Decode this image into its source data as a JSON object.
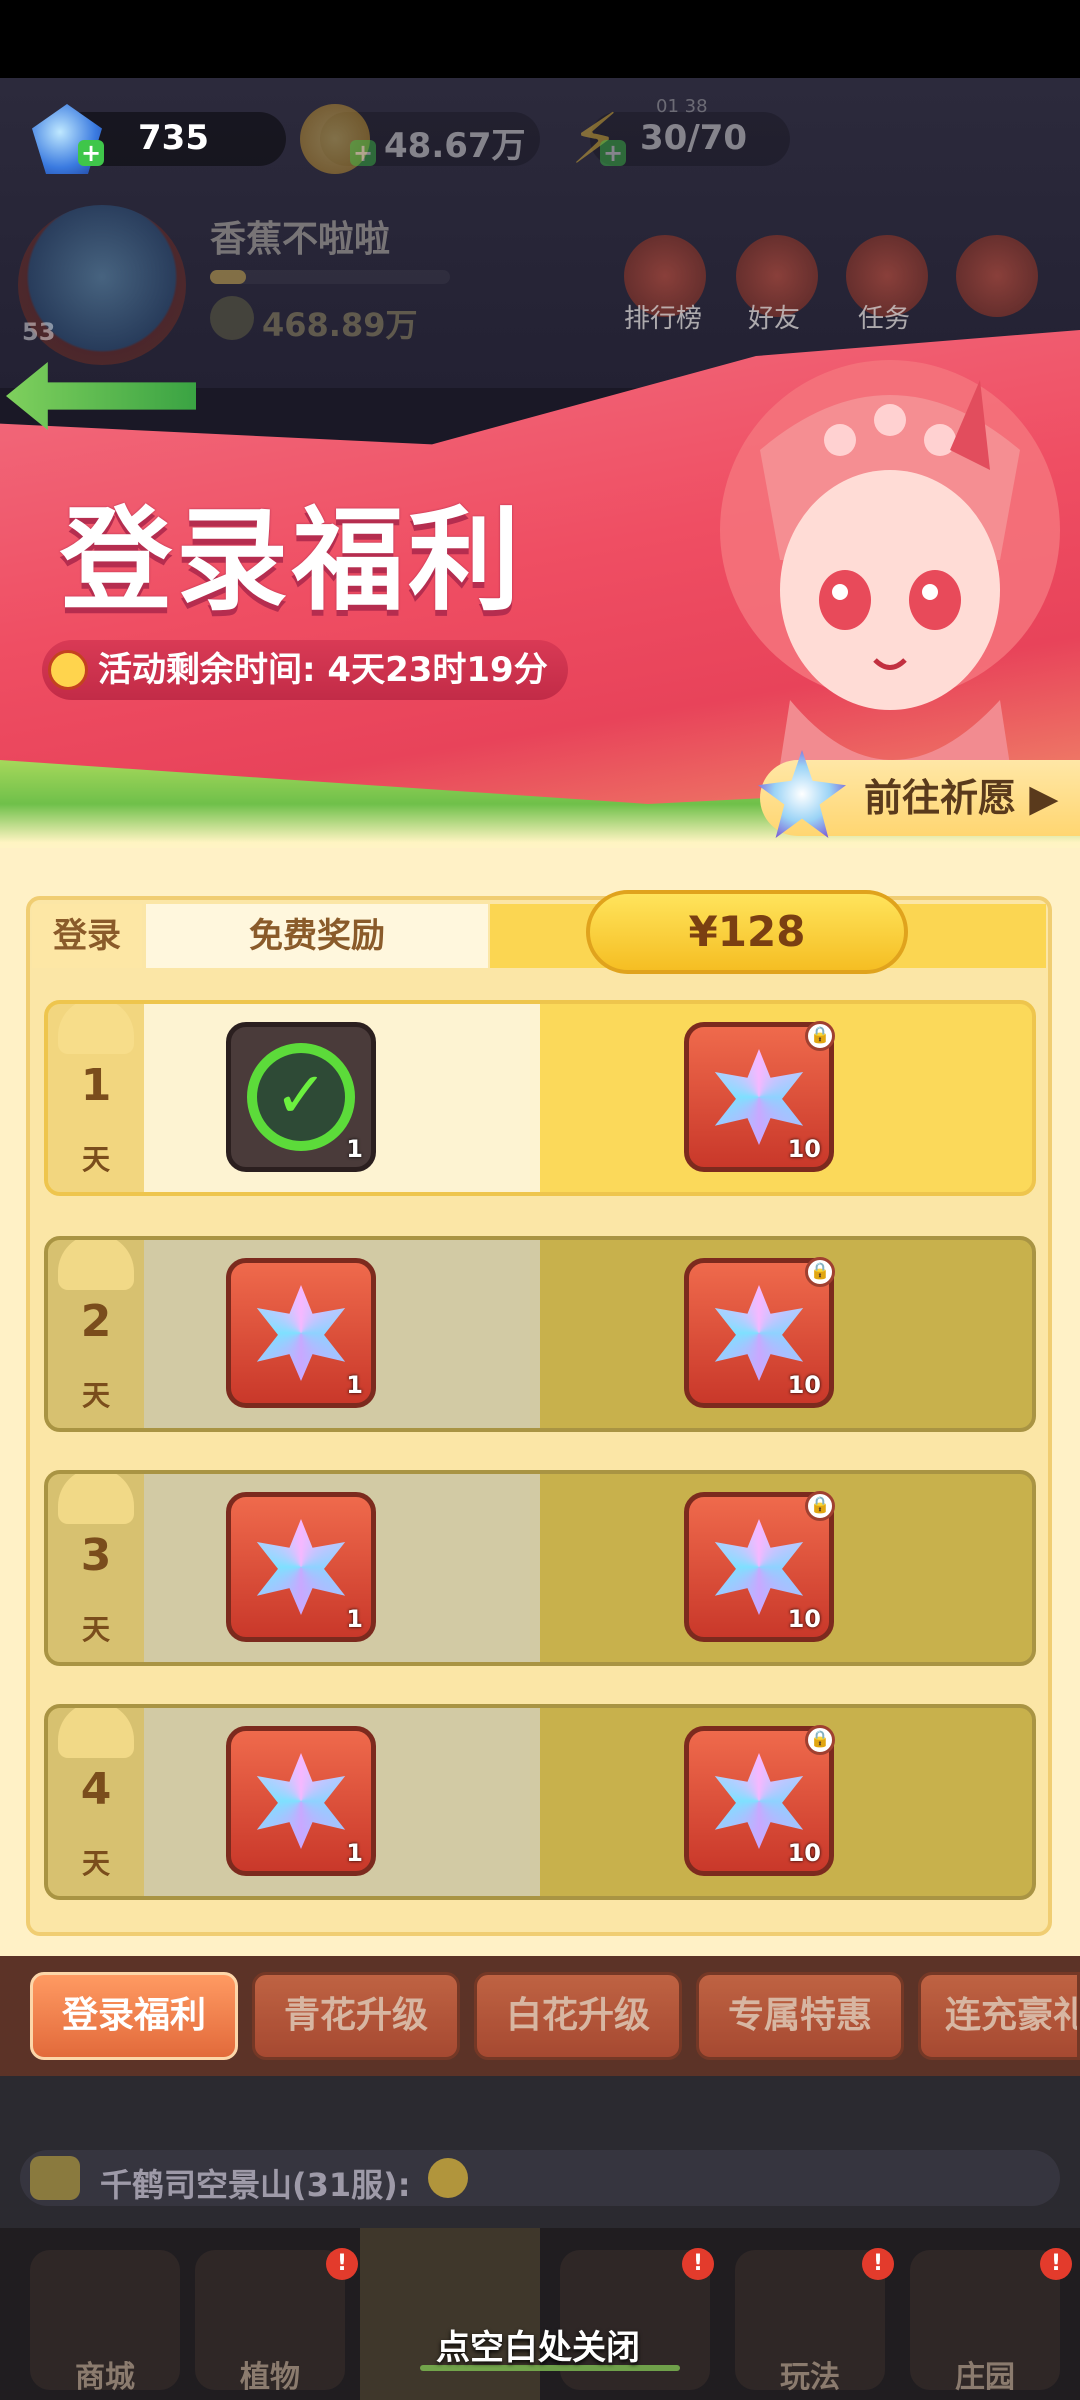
{
  "resources": {
    "gems": "735",
    "gold": "48.67万",
    "energy": "30/70",
    "energy_timer": "01 38"
  },
  "player": {
    "name": "香蕉不啦啦",
    "level": "53",
    "power": "468.89万"
  },
  "top_nav": [
    {
      "label": "排行榜",
      "icon": "ranking-icon"
    },
    {
      "label": "好友",
      "icon": "friends-icon"
    },
    {
      "label": "任务",
      "icon": "task-icon"
    },
    {
      "label": "",
      "icon": "more-icon"
    }
  ],
  "banner": {
    "title": "登录福利",
    "timer_label": "活动剩余时间: 4天23时19分",
    "go_button": "前往祈愿 ▶"
  },
  "table": {
    "header_login": "登录",
    "header_free": "免费奖励",
    "price": "¥128",
    "day_unit": "天",
    "rows": [
      {
        "day": "1",
        "free": {
          "icon": "check-icon",
          "count": "1",
          "claimed": true
        },
        "paid": {
          "icon": "star-crystal-icon",
          "count": "10",
          "locked": true
        }
      },
      {
        "day": "2",
        "free": {
          "icon": "star-crystal-icon",
          "count": "1",
          "claimed": false
        },
        "paid": {
          "icon": "star-crystal-icon",
          "count": "10",
          "locked": true
        }
      },
      {
        "day": "3",
        "free": {
          "icon": "star-crystal-icon",
          "count": "1",
          "claimed": false
        },
        "paid": {
          "icon": "star-crystal-icon",
          "count": "10",
          "locked": true
        }
      },
      {
        "day": "4",
        "free": {
          "icon": "star-crystal-icon",
          "count": "1",
          "claimed": false
        },
        "paid": {
          "icon": "star-crystal-icon",
          "count": "10",
          "locked": true
        }
      }
    ]
  },
  "tabs": [
    {
      "label": "登录福利",
      "active": true
    },
    {
      "label": "青花升级",
      "active": false
    },
    {
      "label": "白花升级",
      "active": false
    },
    {
      "label": "专属特惠",
      "active": false
    },
    {
      "label": "连充豪礼",
      "active": false
    }
  ],
  "chat": {
    "text": "千鹤司空景山(31服):"
  },
  "dock": [
    {
      "label": "商城",
      "badge": ""
    },
    {
      "label": "植物",
      "badge": "!"
    },
    {
      "label": "",
      "badge": ""
    },
    {
      "label": "",
      "badge": "!"
    },
    {
      "label": "玩法",
      "badge": "!"
    },
    {
      "label": "庄园",
      "badge": "!"
    }
  ],
  "close_hint": "点空白处关闭",
  "colors": {
    "accent": "#f5be23",
    "banner": "#ef4e63",
    "tab_active": "#e26a3b"
  }
}
